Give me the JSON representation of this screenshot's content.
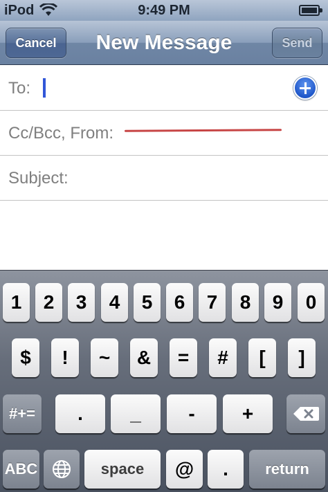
{
  "status_bar": {
    "carrier": "iPod",
    "time": "9:49 PM",
    "battery_level": 0.9,
    "icons": [
      "wifi-icon",
      "battery-icon"
    ]
  },
  "nav": {
    "cancel_label": "Cancel",
    "title": "New Message",
    "send_label": "Send"
  },
  "fields": {
    "to_label": "To:",
    "cc_label": "Cc/Bcc, From:",
    "subject_label": "Subject:",
    "to_value": "",
    "subject_value": ""
  },
  "keyboard": {
    "digits": [
      "1",
      "2",
      "3",
      "4",
      "5",
      "6",
      "7",
      "8",
      "9",
      "0"
    ],
    "symbols": [
      "$",
      "!",
      "~",
      "&",
      "=",
      "#",
      "[",
      "]"
    ],
    "row3": {
      "mode_label": "#+=",
      "keys": [
        ".",
        "_",
        "-",
        "+"
      ],
      "delete_icon": "delete-icon"
    },
    "row4": {
      "abc_label": "ABC",
      "globe_icon": "globe-icon",
      "space_label": "space",
      "at_label": "@",
      "dot_label": ".",
      "return_label": "return"
    }
  },
  "colors": {
    "nav_blue": "#6f86a5",
    "cursor": "#3257d8",
    "add_button": "#1f57c9",
    "redaction": "#c74545"
  }
}
